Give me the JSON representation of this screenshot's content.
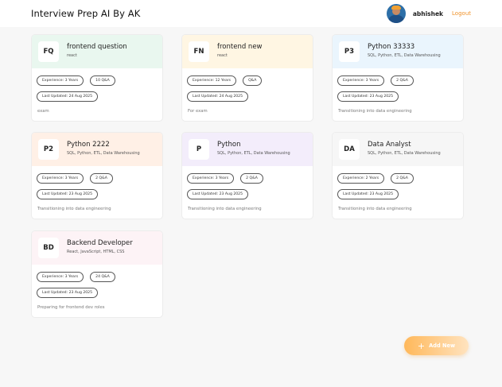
{
  "header": {
    "title": "Interview Prep AI By AK",
    "username": "abhishek",
    "logout_label": "Logout"
  },
  "cards": [
    {
      "initials": "FQ",
      "title": "frontend question",
      "topics": "react",
      "experience": "Experience: 3 Years",
      "qa": "10 Q&A",
      "updated": "Last Updated: 24 Aug 2025",
      "description": "exam",
      "tint": "#e9f7ef"
    },
    {
      "initials": "FN",
      "title": "frontend new",
      "topics": "react",
      "experience": "Experience: 12 Years",
      "qa": "Q&A",
      "updated": "Last Updated: 24 Aug 2025",
      "description": "For exam",
      "tint": "#fff6e3"
    },
    {
      "initials": "P3",
      "title": "Python 33333",
      "topics": "SQL, Python, ETL, Data Warehousing",
      "experience": "Experience: 3 Years",
      "qa": "2 Q&A",
      "updated": "Last Updated: 23 Aug 2025",
      "description": "Transitioning into data engineering",
      "tint": "#eaf5fd"
    },
    {
      "initials": "P2",
      "title": "Python 2222",
      "topics": "SQL, Python, ETL, Data Warehousing",
      "experience": "Experience: 3 Years",
      "qa": "2 Q&A",
      "updated": "Last Updated: 23 Aug 2025",
      "description": "Transitioning into data engineering",
      "tint": "#fff0e6"
    },
    {
      "initials": "P",
      "title": "Python",
      "topics": "SQL, Python, ETL, Data Warehousing",
      "experience": "Experience: 3 Years",
      "qa": "2 Q&A",
      "updated": "Last Updated: 23 Aug 2025",
      "description": "Transitioning into data engineering",
      "tint": "#f3edfb"
    },
    {
      "initials": "DA",
      "title": "Data Analyst",
      "topics": "SQL, Python, ETL, Data Warehousing",
      "experience": "Experience: 2 Years",
      "qa": "2 Q&A",
      "updated": "Last Updated: 23 Aug 2025",
      "description": "Transitioning into data engineering",
      "tint": "#f6f6f6"
    },
    {
      "initials": "BD",
      "title": "Backend Developer",
      "topics": "React, JavaScript, HTML, CSS",
      "experience": "Experience: 3 Years",
      "qa": "24 Q&A",
      "updated": "Last Updated: 23 Aug 2025",
      "description": "Preparing for frontend dev roles",
      "tint": "#fdf3f6"
    }
  ],
  "add_button": {
    "icon": "plus-icon",
    "label": "Add New"
  }
}
